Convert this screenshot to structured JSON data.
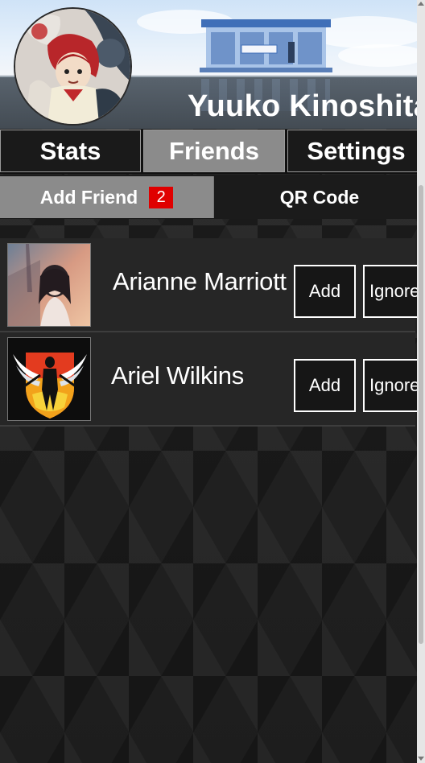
{
  "profile": {
    "name": "Yuuko Kinoshita",
    "avatar_icon": "anime-character-avatar"
  },
  "tabs": [
    {
      "label": "Stats",
      "active": false
    },
    {
      "label": "Friends",
      "active": true
    },
    {
      "label": "Settings",
      "active": false
    }
  ],
  "subtabs": {
    "add_friend_label": "Add Friend",
    "add_friend_badge": "2",
    "qr_code_label": "QR Code"
  },
  "requests": [
    {
      "name": "Arianne Marriott",
      "add_label": "Add",
      "ignore_label": "Ignore",
      "thumb_icon": "anime-girl-thumbnail"
    },
    {
      "name": "Ariel Wilkins",
      "add_label": "Add",
      "ignore_label": "Ignore",
      "thumb_icon": "wings-of-freedom-thumbnail"
    }
  ],
  "colors": {
    "active_tab": "#8b8b8b",
    "badge": "#e00000",
    "background": "#222222"
  }
}
